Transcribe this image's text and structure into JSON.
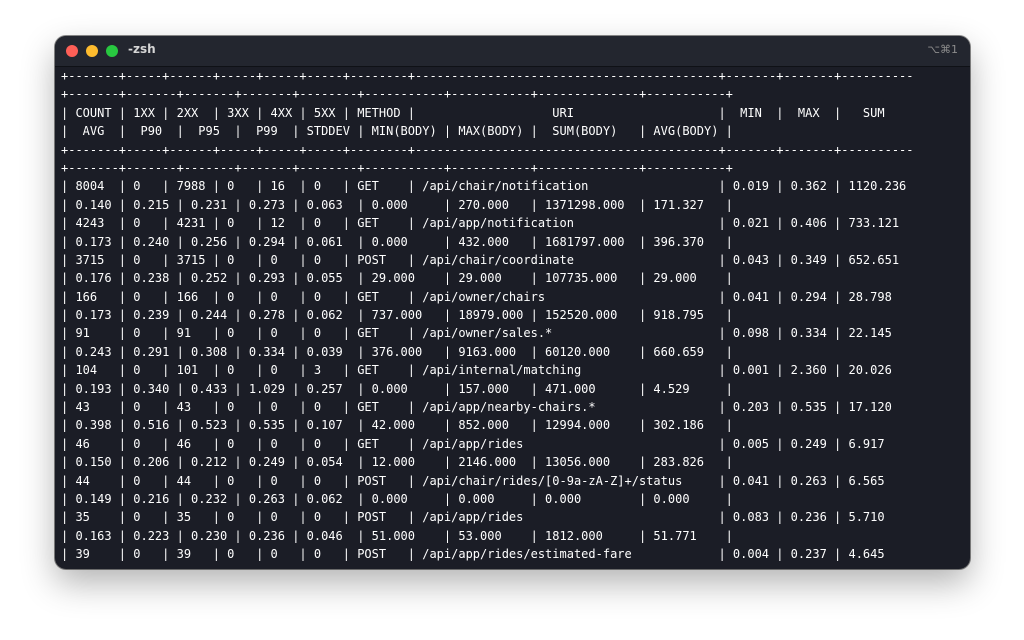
{
  "window": {
    "title": "-zsh",
    "shortcut": "⌥⌘1"
  },
  "terminal": {
    "lines": [
      "+-------+-----+------+-----+-----+-----+--------+------------------------------------------+-------+-------+----------",
      "+-------+-------+-------+-------+--------+-----------+-----------+--------------+-----------+",
      "| COUNT | 1XX | 2XX  | 3XX | 4XX | 5XX | METHOD |                   URI                    |  MIN  |  MAX  |   SUM",
      "|  AVG  |  P90  |  P95  |  P99  | STDDEV | MIN(BODY) | MAX(BODY) |  SUM(BODY)   | AVG(BODY) |",
      "+-------+-----+------+-----+-----+-----+--------+------------------------------------------+-------+-------+----------",
      "+-------+-------+-------+-------+--------+-----------+-----------+--------------+-----------+",
      "| 8004  | 0   | 7988 | 0   | 16  | 0   | GET    | /api/chair/notification                  | 0.019 | 0.362 | 1120.236",
      "| 0.140 | 0.215 | 0.231 | 0.273 | 0.063  | 0.000     | 270.000   | 1371298.000  | 171.327   |",
      "| 4243  | 0   | 4231 | 0   | 12  | 0   | GET    | /api/app/notification                    | 0.021 | 0.406 | 733.121",
      "| 0.173 | 0.240 | 0.256 | 0.294 | 0.061  | 0.000     | 432.000   | 1681797.000  | 396.370   |",
      "| 3715  | 0   | 3715 | 0   | 0   | 0   | POST   | /api/chair/coordinate                    | 0.043 | 0.349 | 652.651",
      "| 0.176 | 0.238 | 0.252 | 0.293 | 0.055  | 29.000    | 29.000    | 107735.000   | 29.000    |",
      "| 166   | 0   | 166  | 0   | 0   | 0   | GET    | /api/owner/chairs                        | 0.041 | 0.294 | 28.798",
      "| 0.173 | 0.239 | 0.244 | 0.278 | 0.062  | 737.000   | 18979.000 | 152520.000   | 918.795   |",
      "| 91    | 0   | 91   | 0   | 0   | 0   | GET    | /api/owner/sales.*                       | 0.098 | 0.334 | 22.145",
      "| 0.243 | 0.291 | 0.308 | 0.334 | 0.039  | 376.000   | 9163.000  | 60120.000    | 660.659   |",
      "| 104   | 0   | 101  | 0   | 0   | 3   | GET    | /api/internal/matching                   | 0.001 | 2.360 | 20.026",
      "| 0.193 | 0.340 | 0.433 | 1.029 | 0.257  | 0.000     | 157.000   | 471.000      | 4.529     |",
      "| 43    | 0   | 43   | 0   | 0   | 0   | GET    | /api/app/nearby-chairs.*                 | 0.203 | 0.535 | 17.120",
      "| 0.398 | 0.516 | 0.523 | 0.535 | 0.107  | 42.000    | 852.000   | 12994.000    | 302.186   |",
      "| 46    | 0   | 46   | 0   | 0   | 0   | GET    | /api/app/rides                           | 0.005 | 0.249 | 6.917",
      "| 0.150 | 0.206 | 0.212 | 0.249 | 0.054  | 12.000    | 2146.000  | 13056.000    | 283.826   |",
      "| 44    | 0   | 44   | 0   | 0   | 0   | POST   | /api/chair/rides/[0-9a-zA-Z]+/status     | 0.041 | 0.263 | 6.565",
      "| 0.149 | 0.216 | 0.232 | 0.263 | 0.062  | 0.000     | 0.000     | 0.000        | 0.000     |",
      "| 35    | 0   | 35   | 0   | 0   | 0   | POST   | /api/app/rides                           | 0.083 | 0.236 | 5.710",
      "| 0.163 | 0.223 | 0.230 | 0.236 | 0.046  | 51.000    | 53.000    | 1812.000     | 51.771    |",
      "| 39    | 0   | 39   | 0   | 0   | 0   | POST   | /api/app/rides/estimated-fare            | 0.004 | 0.237 | 4.645"
    ]
  }
}
